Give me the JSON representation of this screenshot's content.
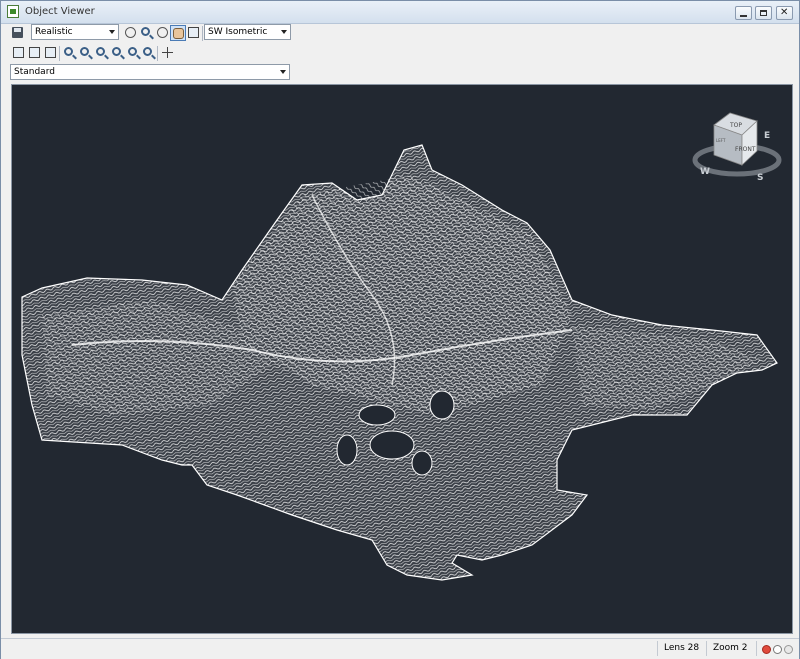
{
  "window": {
    "title": "Object Viewer",
    "close_glyph": "✕"
  },
  "toolbar": {
    "visual_style": "Realistic",
    "view_preset": "SW Isometric",
    "ucs": "Standard"
  },
  "viewcube": {
    "top_label": "TOP",
    "front_label": "FRONT",
    "left_label": "LEFT",
    "compass_w": "W",
    "compass_s": "S",
    "compass_e": "E"
  },
  "statusbar": {
    "lens": "Lens 28",
    "zoom": "Zoom 2"
  },
  "colors": {
    "viewport_bg": "#222831",
    "contour": "#ffffff"
  },
  "icons": [
    "app-icon",
    "save-icon",
    "orbit-icon",
    "zoom-icon",
    "pan-icon",
    "view-icon",
    "zoom-in-icon",
    "zoom-out-icon",
    "zoom-extents-icon",
    "crosshair-icon"
  ]
}
